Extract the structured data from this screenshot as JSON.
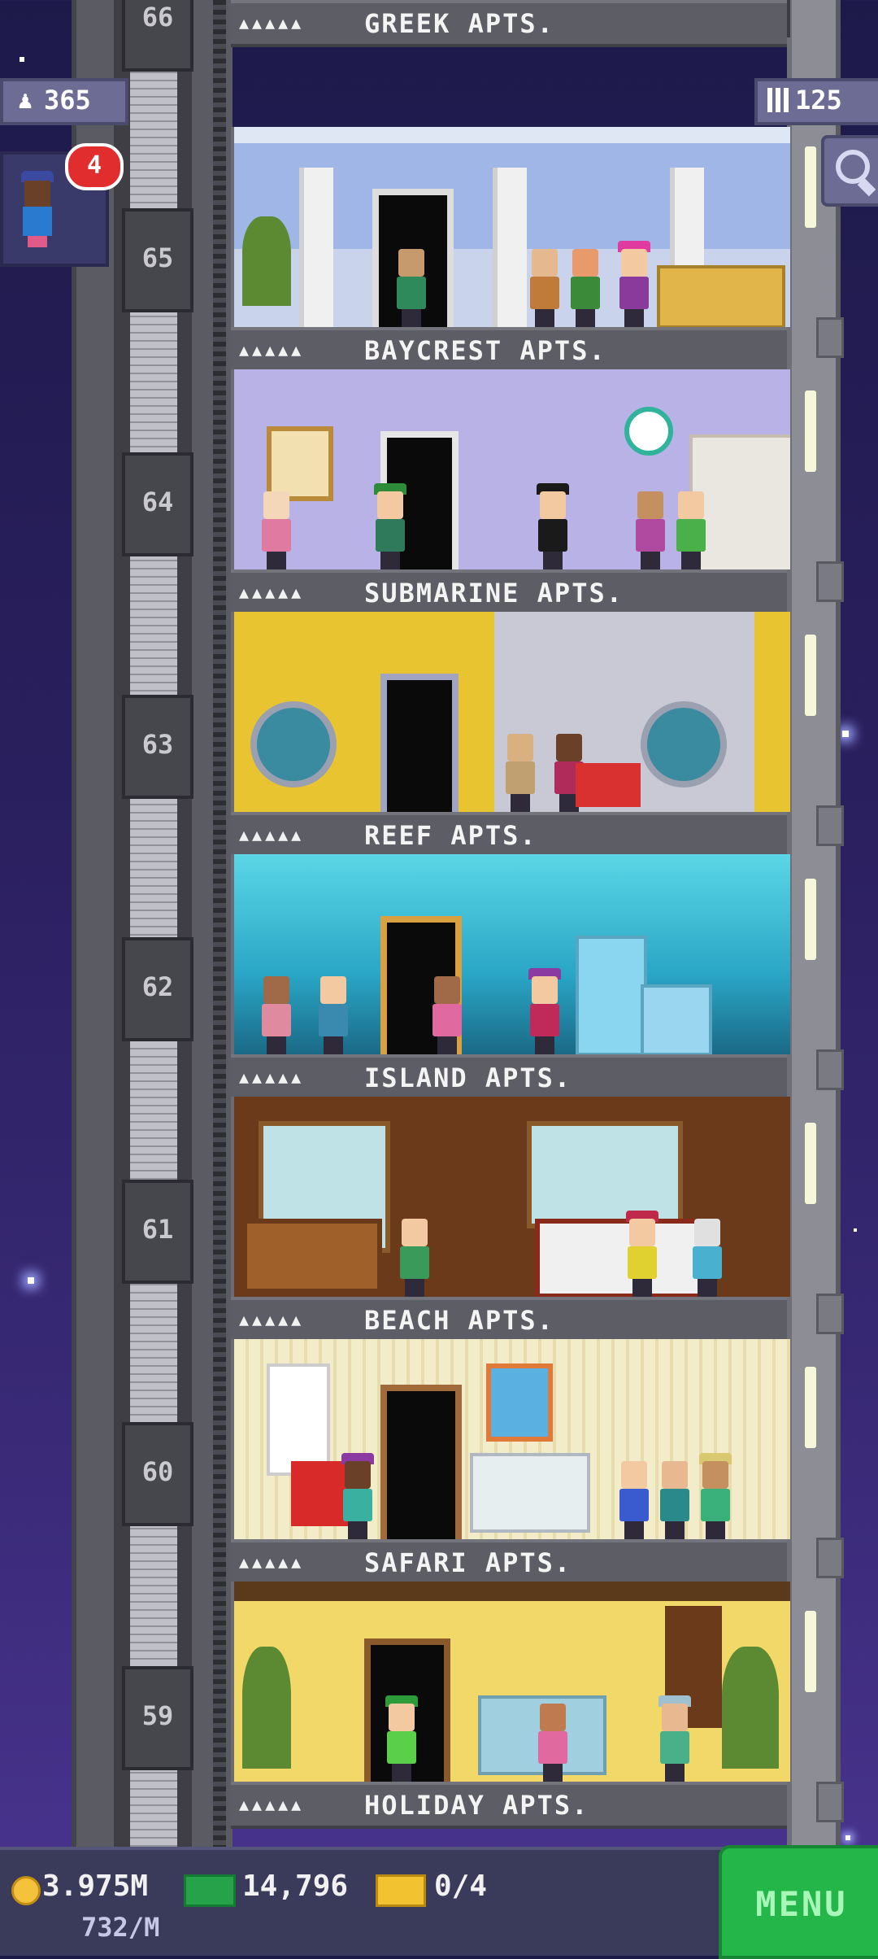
{
  "hud": {
    "population": "365",
    "floors_count": "125",
    "notification_count": "4"
  },
  "floors": [
    {
      "number": "66",
      "name": "GREEK APTS.",
      "stars": "▲▲▲▲▲"
    },
    {
      "number": "65",
      "name": "BAYCREST APTS.",
      "stars": "▲▲▲▲▲"
    },
    {
      "number": "64",
      "name": "SUBMARINE APTS.",
      "stars": "▲▲▲▲▲"
    },
    {
      "number": "63",
      "name": "REEF APTS.",
      "stars": "▲▲▲▲▲"
    },
    {
      "number": "62",
      "name": "ISLAND APTS.",
      "stars": "▲▲▲▲▲"
    },
    {
      "number": "61",
      "name": "BEACH APTS.",
      "stars": "▲▲▲▲▲"
    },
    {
      "number": "60",
      "name": "SAFARI APTS.",
      "stars": "▲▲▲▲▲"
    },
    {
      "number": "59",
      "name": "HOLIDAY APTS.",
      "stars": "▲▲▲▲▲"
    }
  ],
  "bottom": {
    "coins": "3.975M",
    "coin_rate": "732/M",
    "bux": "14,796",
    "tickets": "0/4",
    "menu_label": "MENU"
  },
  "colors": {
    "menu_green": "#25b64a",
    "badge_red": "#e12d2d",
    "coin_gold": "#f5c33b"
  },
  "icons": [
    "population-icon",
    "floors-icon",
    "search-icon",
    "coin-icon",
    "bux-icon",
    "ticket-icon"
  ]
}
